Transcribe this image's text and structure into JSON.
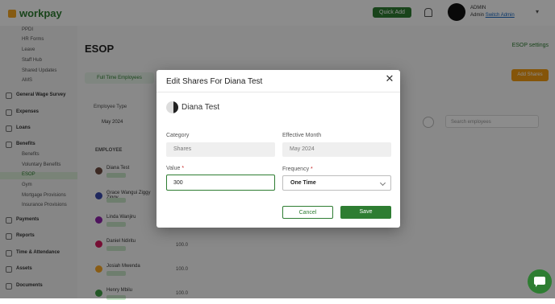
{
  "app": {
    "logo": "workpay",
    "top_button": "Quick Add",
    "user_name": "ADMIN",
    "user_role": "Admin",
    "user_link": "Switch Admin"
  },
  "sidebar": {
    "sub_items_top": [
      "PPDI",
      "HR Forms",
      "Leave",
      "Staff Hub",
      "Shared Updates",
      "AMS"
    ],
    "main_items": [
      {
        "label": "General Wage Survey"
      },
      {
        "label": "Expenses"
      },
      {
        "label": "Loans"
      },
      {
        "label": "Benefits"
      }
    ],
    "benefit_sub_items": [
      "Benefits",
      "Voluntary Benefits",
      "ESOP",
      "Gym",
      "Mortgage Provisions",
      "Insurance Provisions"
    ],
    "bottom_items": [
      {
        "label": "Payments"
      },
      {
        "label": "Reports"
      },
      {
        "label": "Time & Attendance"
      },
      {
        "label": "Assets"
      },
      {
        "label": "Documents"
      }
    ]
  },
  "main": {
    "page_title": "ESOP",
    "setup_link": "ESOP settings",
    "active_tab": "Full Time Employees",
    "action_button": "Add Shares",
    "emp_type_label": "Employee Type",
    "emp_type_value": "May 2024",
    "employee_header": "EMPLOYEE",
    "search_placeholder": "Search employees",
    "employees": [
      {
        "name": "Diana Test",
        "color": "#6d4c41"
      },
      {
        "name": "Grace Wangui Ziggy Ziggy",
        "color": "#3949ab"
      },
      {
        "name": "Linda Wanjiru",
        "color": "#8e24aa"
      },
      {
        "name": "Daniel Ndiritu",
        "color": "#d81b60"
      },
      {
        "name": "Josiah Mwenda",
        "color": "#f9a825"
      },
      {
        "name": "Henry Mbilu",
        "color": "#43a047"
      }
    ],
    "row_values": [
      "100.0",
      "100.0",
      "100.0"
    ]
  },
  "modal": {
    "title": "Edit Shares For Diana Test",
    "employee_name": "Diana Test",
    "category_label": "Category",
    "category_value": "Shares",
    "effective_month_label": "Effective Month",
    "effective_month_value": "May 2024",
    "value_label": "Value",
    "value_value": "300",
    "frequency_label": "Frequency",
    "frequency_value": "One Time",
    "required_mark": "*",
    "cancel_label": "Cancel",
    "save_label": "Save"
  },
  "colors": {
    "accent": "#2e7d32",
    "overlay": "rgba(0,0,0,0.45)",
    "required": "#c62828"
  }
}
